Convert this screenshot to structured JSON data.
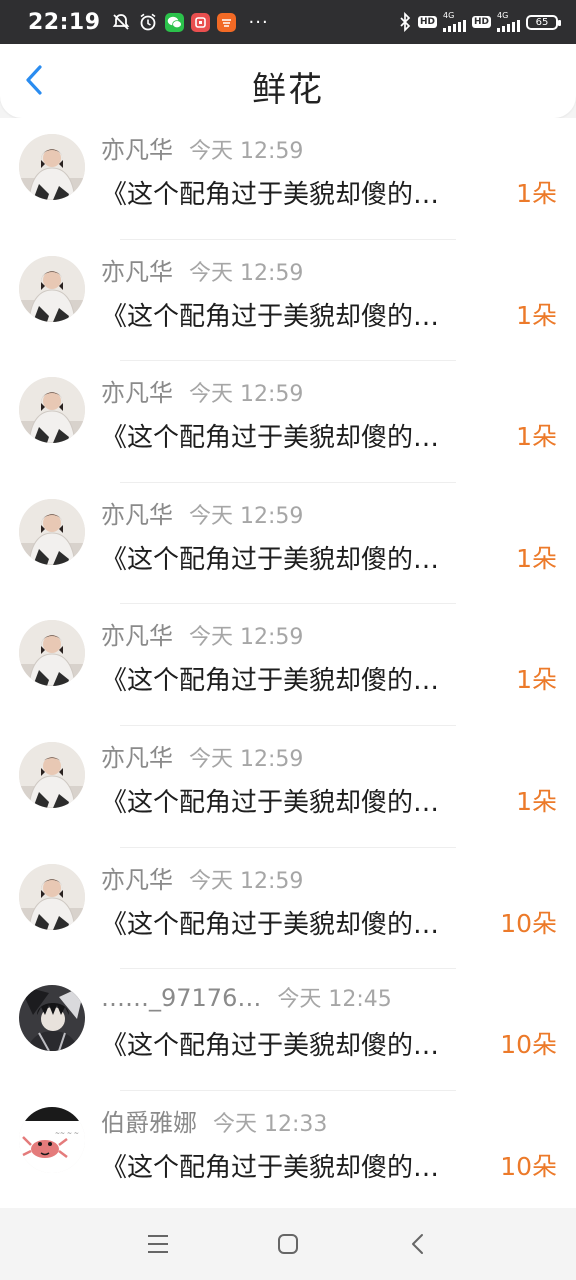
{
  "status_bar": {
    "time": "22:19",
    "battery": "65",
    "network_a": "4G",
    "network_b": "4G",
    "hd_a": "HD",
    "hd_b": "HD",
    "more": "···"
  },
  "header": {
    "title": "鲜花"
  },
  "accent_color": "#ec7a2a",
  "list": [
    {
      "name": "亦凡华",
      "time": "今天 12:59",
      "text": "《这个配角过于美貌却傻的…",
      "count": "1朵",
      "avatar": "photo-girl"
    },
    {
      "name": "亦凡华",
      "time": "今天 12:59",
      "text": "《这个配角过于美貌却傻的…",
      "count": "1朵",
      "avatar": "photo-girl"
    },
    {
      "name": "亦凡华",
      "time": "今天 12:59",
      "text": "《这个配角过于美貌却傻的…",
      "count": "1朵",
      "avatar": "photo-girl"
    },
    {
      "name": "亦凡华",
      "time": "今天 12:59",
      "text": "《这个配角过于美貌却傻的…",
      "count": "1朵",
      "avatar": "photo-girl"
    },
    {
      "name": "亦凡华",
      "time": "今天 12:59",
      "text": "《这个配角过于美貌却傻的…",
      "count": "1朵",
      "avatar": "photo-girl"
    },
    {
      "name": "亦凡华",
      "time": "今天 12:59",
      "text": "《这个配角过于美貌却傻的…",
      "count": "1朵",
      "avatar": "photo-girl"
    },
    {
      "name": "亦凡华",
      "time": "今天 12:59",
      "text": "《这个配角过于美貌却傻的…",
      "count": "10朵",
      "avatar": "photo-girl"
    },
    {
      "name": "……_97176…",
      "time": "今天 12:45",
      "text": "《这个配角过于美貌却傻的…",
      "count": "10朵",
      "avatar": "anime-dark"
    },
    {
      "name": "伯爵雅娜",
      "time": "今天 12:33",
      "text": "《这个配角过于美貌却傻的…",
      "count": "10朵",
      "avatar": "crab-sticker"
    }
  ]
}
